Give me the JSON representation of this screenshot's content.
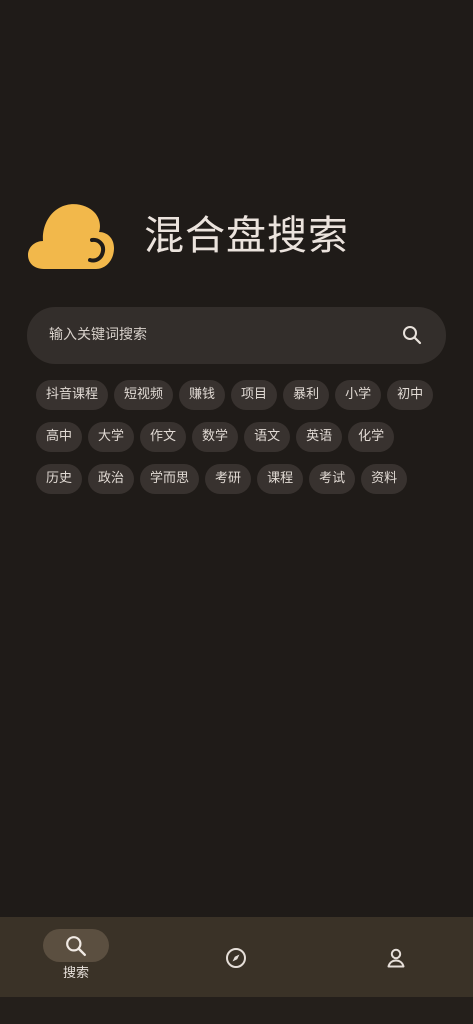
{
  "app": {
    "title": "混合盘搜索",
    "brand_color": "#f2b84b"
  },
  "search": {
    "placeholder": "输入关键词搜索"
  },
  "tags": [
    [
      "抖音课程",
      "短视频",
      "赚钱",
      "项目",
      "暴利",
      "小学",
      "初中"
    ],
    [
      "高中",
      "大学",
      "作文",
      "数学",
      "语文",
      "英语",
      "化学"
    ],
    [
      "历史",
      "政治",
      "学而思",
      "考研",
      "课程",
      "考试",
      "资料"
    ]
  ],
  "bottom_nav": {
    "items": [
      {
        "id": "search",
        "label": "搜索",
        "icon": "search-icon",
        "active": true
      },
      {
        "id": "discover",
        "label": "",
        "icon": "compass-icon",
        "active": false
      },
      {
        "id": "profile",
        "label": "",
        "icon": "person-icon",
        "active": false
      }
    ]
  }
}
